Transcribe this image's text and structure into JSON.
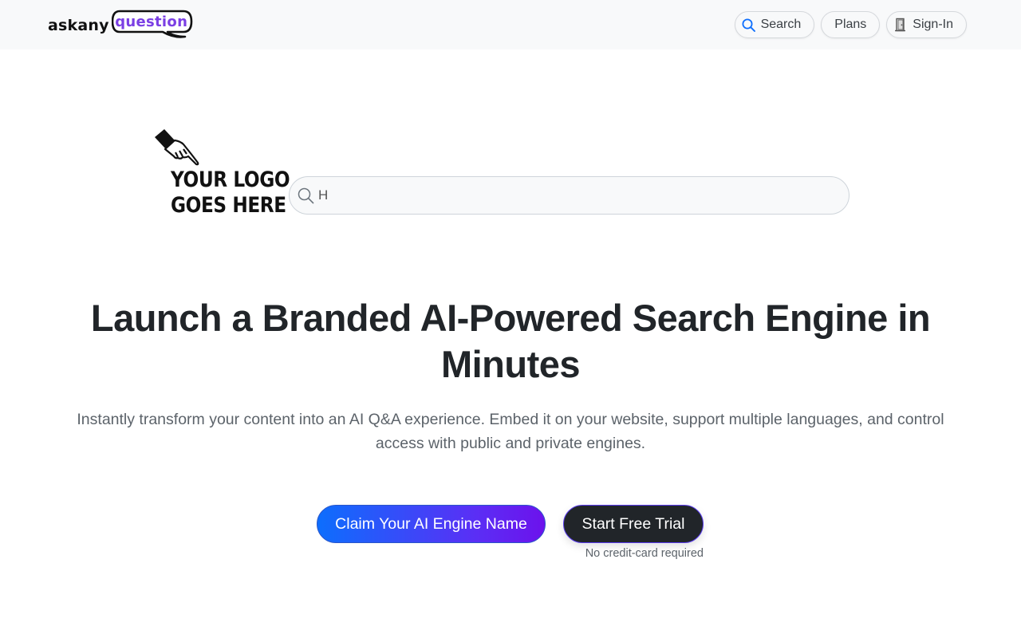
{
  "header": {
    "brand": {
      "prefix": "askany",
      "highlight": "question"
    },
    "nav": {
      "search_label": "Search",
      "plans_label": "Plans",
      "signin_label": "Sign-In"
    }
  },
  "engine": {
    "logo_line1": "YOUR LOGO",
    "logo_line2": "GOES HERE",
    "search_value": "H"
  },
  "hero": {
    "title_line1": "Launch a Branded AI-Powered Search Engine in",
    "title_line2": "Minutes",
    "subtitle_line1": "Instantly transform your content into an AI Q&A experience. Embed it on your website, support multiple languages, and control",
    "subtitle_line2": "access with public and private engines.",
    "primary_cta": "Claim Your AI Engine Name",
    "secondary_cta": "Start Free Trial",
    "note": "No credit-card required"
  },
  "colors": {
    "accent_blue": "#0d6efd",
    "accent_purple": "#6c12ec",
    "dark_button": "#212529"
  },
  "icons": {
    "nav_search": "search-icon",
    "nav_signin": "door-icon",
    "field_search": "search-icon",
    "logo_placeholder": "pointing-hand-icon"
  }
}
